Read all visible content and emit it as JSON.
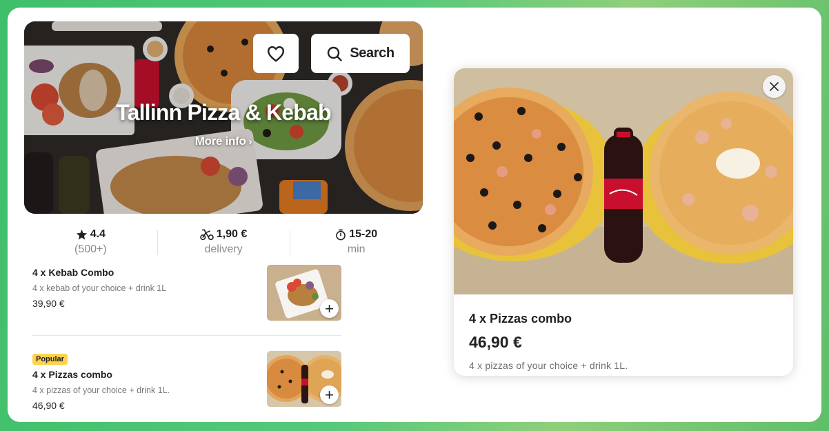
{
  "restaurant": {
    "name": "Tallinn Pizza & Kebab",
    "more_info_label": "More info",
    "search_label": "Search"
  },
  "stats": {
    "rating": "4.4",
    "rating_count": "(500+)",
    "delivery_fee": "1,90 €",
    "delivery_label": "delivery",
    "time": "15-20",
    "time_unit": "min"
  },
  "menu": {
    "items": [
      {
        "name": "4 x Kebab Combo",
        "description": "4 x kebab of your choice + drink 1L",
        "price": "39,90 €"
      },
      {
        "badge": "Popular",
        "name": "4 x Pizzas combo",
        "description": "4 x pizzas of your choice + drink 1L.",
        "price": "46,90 €"
      }
    ]
  },
  "detail": {
    "name": "4 x Pizzas combo",
    "price": "46,90 €",
    "description": "4 x pizzas of your choice + drink 1L."
  },
  "colors": {
    "badge": "#ffd34d",
    "text": "#202125",
    "background_green": "#3fbf6a"
  },
  "icons": [
    "heart-icon",
    "search-icon",
    "star-icon",
    "bike-icon",
    "timer-icon",
    "chevron-right-icon",
    "plus-icon",
    "close-icon"
  ]
}
